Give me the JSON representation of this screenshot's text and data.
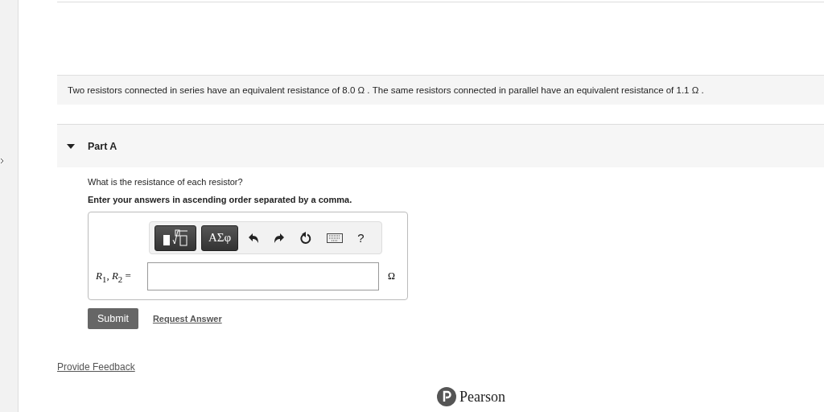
{
  "problem": {
    "text": "Two resistors connected in series have an equivalent resistance of 8.0 Ω . The same resistors connected in parallel have an equivalent resistance of 1.1 Ω ."
  },
  "part": {
    "title": "Part A",
    "expanded": true,
    "question": "What is the resistance of each resistor?",
    "instruction": "Enter your answers in ascending order separated by a comma.",
    "toolbar": {
      "symbols_button": "AΣφ",
      "help": "?"
    },
    "answer": {
      "label": "*R*$_{1}$, *R*$_{2}$ =",
      "unit": "Ω"
    },
    "submit": "Submit",
    "request": "Request Answer"
  },
  "feedback": "Provide Feedback",
  "brand": "Pearson"
}
